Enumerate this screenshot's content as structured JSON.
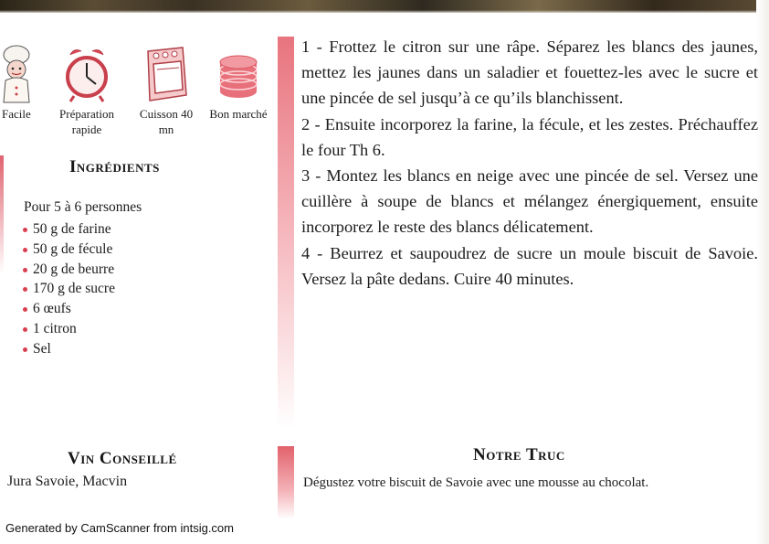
{
  "icons": [
    {
      "name": "chef-icon",
      "label": "Facile"
    },
    {
      "name": "alarm-clock-icon",
      "label": "Préparation rapide"
    },
    {
      "name": "oven-icon",
      "label": "Cuisson 40 mn"
    },
    {
      "name": "coin-stack-icon",
      "label": "Bon marché"
    }
  ],
  "ingredients": {
    "title": "Ingrédients",
    "serves": "Pour 5 à 6 personnes",
    "items": [
      "50 g de farine",
      "50 g de fécule",
      "20 g de beurre",
      "170 g de sucre",
      "6 œufs",
      "1 citron",
      "Sel"
    ]
  },
  "steps": [
    "1 - Frottez le citron sur une râpe. Séparez les blancs des jaunes, mettez les jaunes dans un saladier et fouettez-les avec le sucre et une pincée de sel jusqu’à ce qu’ils blanchissent.",
    "2 - Ensuite incorporez la farine, la fécule, et les zestes. Préchauffez le four Th 6.",
    "3 - Montez les blancs en neige avec une pincée de sel. Versez une cuillère à soupe de blancs et mélangez énergiquement, ensuite incorporez le reste des blancs délicatement.",
    "4 - Beurrez et saupoudrez de sucre un moule biscuit de Savoie. Versez la pâte dedans. Cuire 40 minutes."
  ],
  "wine": {
    "title": "Vin Conseillé",
    "text": "Jura Savoie, Macvin"
  },
  "tip": {
    "title": "Notre Truc",
    "text": "Dégustez votre biscuit de Savoie avec une mousse au chocolat."
  },
  "footer": "Generated by CamScanner from intsig.com",
  "colors": {
    "accent": "#d9404f",
    "bar": "#e8747e"
  }
}
